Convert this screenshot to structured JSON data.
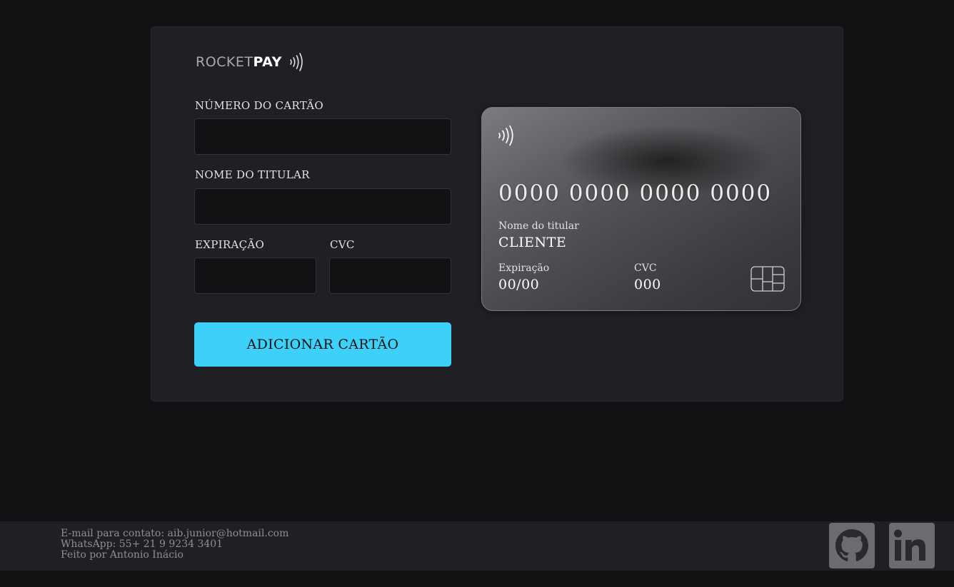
{
  "brand": {
    "logo_prefix": "ROCKET",
    "logo_suffix": "PAY",
    "logo_icon": "contactless-icon"
  },
  "form": {
    "card_number_label": "NÚMERO DO CARTÃO",
    "card_number_value": "",
    "holder_label": "NOME DO TITULAR",
    "holder_value": "",
    "expiration_label": "EXPIRAÇÃO",
    "expiration_value": "",
    "cvc_label": "CVC",
    "cvc_value": "",
    "submit_label": "ADICIONAR CARTÃO"
  },
  "card": {
    "number": "0000 0000 0000 0000",
    "holder_label": "Nome do titular",
    "holder_value": "CLIENTE",
    "expiration_label": "Expiração",
    "expiration_value": "00/00",
    "cvc_label": "CVC",
    "cvc_value": "000",
    "chip_icon": "card-chip-icon"
  },
  "footer": {
    "email_line": "E-mail para contato: aib.junior@hotmail.com",
    "whatsapp_line": "WhatsApp: 55+ 21 9 9234 3401",
    "credit_line": "Feito por Antonio Inácio",
    "social_icons": [
      "github-icon",
      "linkedin-icon"
    ]
  },
  "colors": {
    "background": "#121214",
    "panel": "#202024",
    "accent": "#3dd1fa",
    "text": "#e1e1e6"
  }
}
